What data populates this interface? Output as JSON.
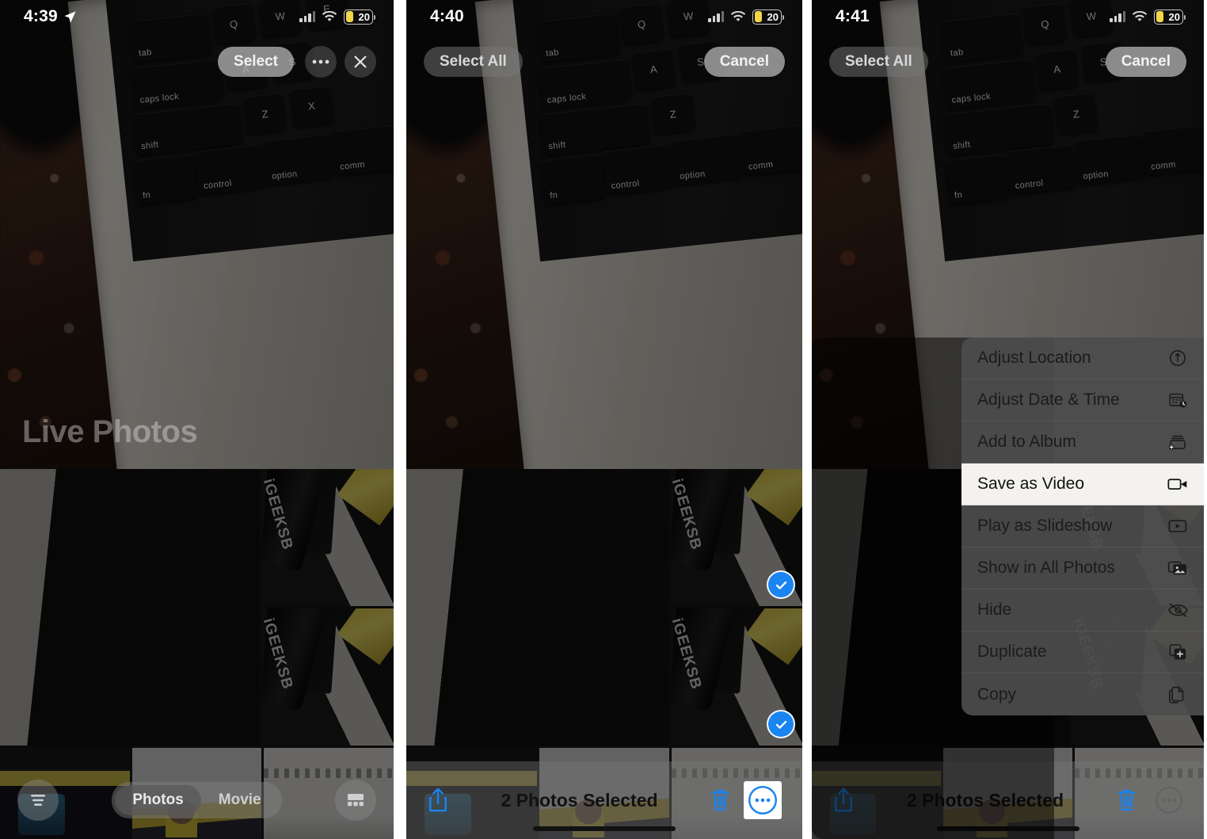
{
  "panels": [
    {
      "id": "panel-browse",
      "status": {
        "time": "4:39",
        "location_arrow": "location-arrow-icon",
        "signal": "cellular-signal-icon",
        "wifi": "wifi-icon",
        "battery_level": "20"
      },
      "top_actions": {
        "select_label": "Select",
        "more_icon": "ellipsis-icon",
        "close_icon": "close-x-icon"
      },
      "album_title": "Live Photos",
      "bottom": {
        "filter_icon": "filter-lines-icon",
        "segmented": {
          "options": [
            "Photos",
            "Movie"
          ],
          "selected": "Photos"
        },
        "layout_icon": "layout-grid-icon"
      }
    },
    {
      "id": "panel-selected",
      "status": {
        "time": "4:40",
        "signal": "cellular-signal-icon",
        "wifi": "wifi-icon",
        "battery_level": "20"
      },
      "top_actions": {
        "select_all_label": "Select All",
        "cancel_label": "Cancel"
      },
      "bottom": {
        "share_icon": "share-upload-icon",
        "count_label": "2 Photos Selected",
        "trash_icon": "trash-icon",
        "more_icon": "more-circle-icon",
        "more_highlighted": true
      },
      "selected_cells": [
        1,
        2
      ]
    },
    {
      "id": "panel-menu",
      "status": {
        "time": "4:41",
        "signal": "cellular-signal-icon",
        "wifi": "wifi-icon",
        "battery_level": "20"
      },
      "top_actions": {
        "select_all_label": "Select All",
        "cancel_label": "Cancel"
      },
      "bottom": {
        "share_icon": "share-upload-icon",
        "count_label": "2 Photos Selected",
        "trash_icon": "trash-icon",
        "more_icon": "more-circle-icon",
        "more_highlighted": false
      },
      "selected_cells": [
        1,
        2
      ],
      "context_menu": {
        "items": [
          {
            "label": "Adjust Location",
            "icon": "location-pin-circle-icon",
            "highlighted": false
          },
          {
            "label": "Adjust Date & Time",
            "icon": "calendar-clock-icon",
            "highlighted": false
          },
          {
            "label": "Add to Album",
            "icon": "album-add-icon",
            "highlighted": false
          },
          {
            "label": "Save as Video",
            "icon": "video-camera-icon",
            "highlighted": true
          },
          {
            "label": "Play as Slideshow",
            "icon": "play-rectangle-icon",
            "highlighted": false
          },
          {
            "label": "Show in All Photos",
            "icon": "photos-stack-icon",
            "highlighted": false
          },
          {
            "label": "Hide",
            "icon": "eye-slash-icon",
            "highlighted": false
          },
          {
            "label": "Duplicate",
            "icon": "duplicate-plus-icon",
            "highlighted": false
          },
          {
            "label": "Copy",
            "icon": "copy-pages-icon",
            "highlighted": false
          }
        ]
      }
    }
  ],
  "colors": {
    "accent_blue": "#1a84f0",
    "battery_yellow": "#f2d64a",
    "highlight_bg": "#f3f2ef"
  },
  "keycaps": {
    "row1": [
      "tab",
      "Q",
      "W",
      "E"
    ],
    "row2": [
      "caps lock",
      "A",
      "S"
    ],
    "row3": [
      "shift",
      "Z",
      "X"
    ],
    "row4": [
      "fn",
      "control",
      "option",
      "comm"
    ]
  }
}
